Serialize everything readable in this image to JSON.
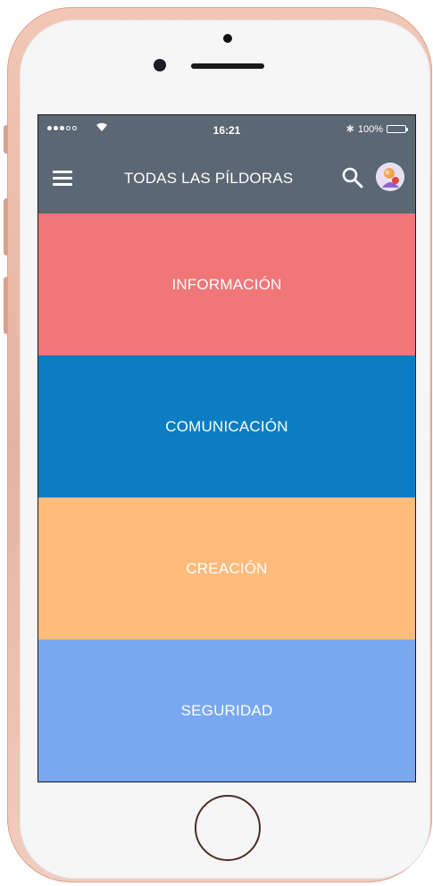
{
  "status_bar": {
    "time": "16:21",
    "battery": "100%",
    "battery_level": 1.0,
    "signal_bars": 3,
    "signal_total": 5
  },
  "header": {
    "title": "TODAS LAS PÍLDORAS",
    "background": "#5b6773",
    "icons": {
      "menu": "hamburger-menu-icon",
      "search": "search-icon",
      "avatar": "user-avatar"
    }
  },
  "categories": [
    {
      "label": "INFORMACIÓN",
      "color": "#f17678"
    },
    {
      "label": "COMUNICACIÓN",
      "color": "#0c7dc2"
    },
    {
      "label": "CREACIÓN",
      "color": "#fdbb7c"
    },
    {
      "label": "SEGURIDAD",
      "color": "#7aa8f0"
    }
  ],
  "device": {
    "color": "#efc4b4"
  }
}
